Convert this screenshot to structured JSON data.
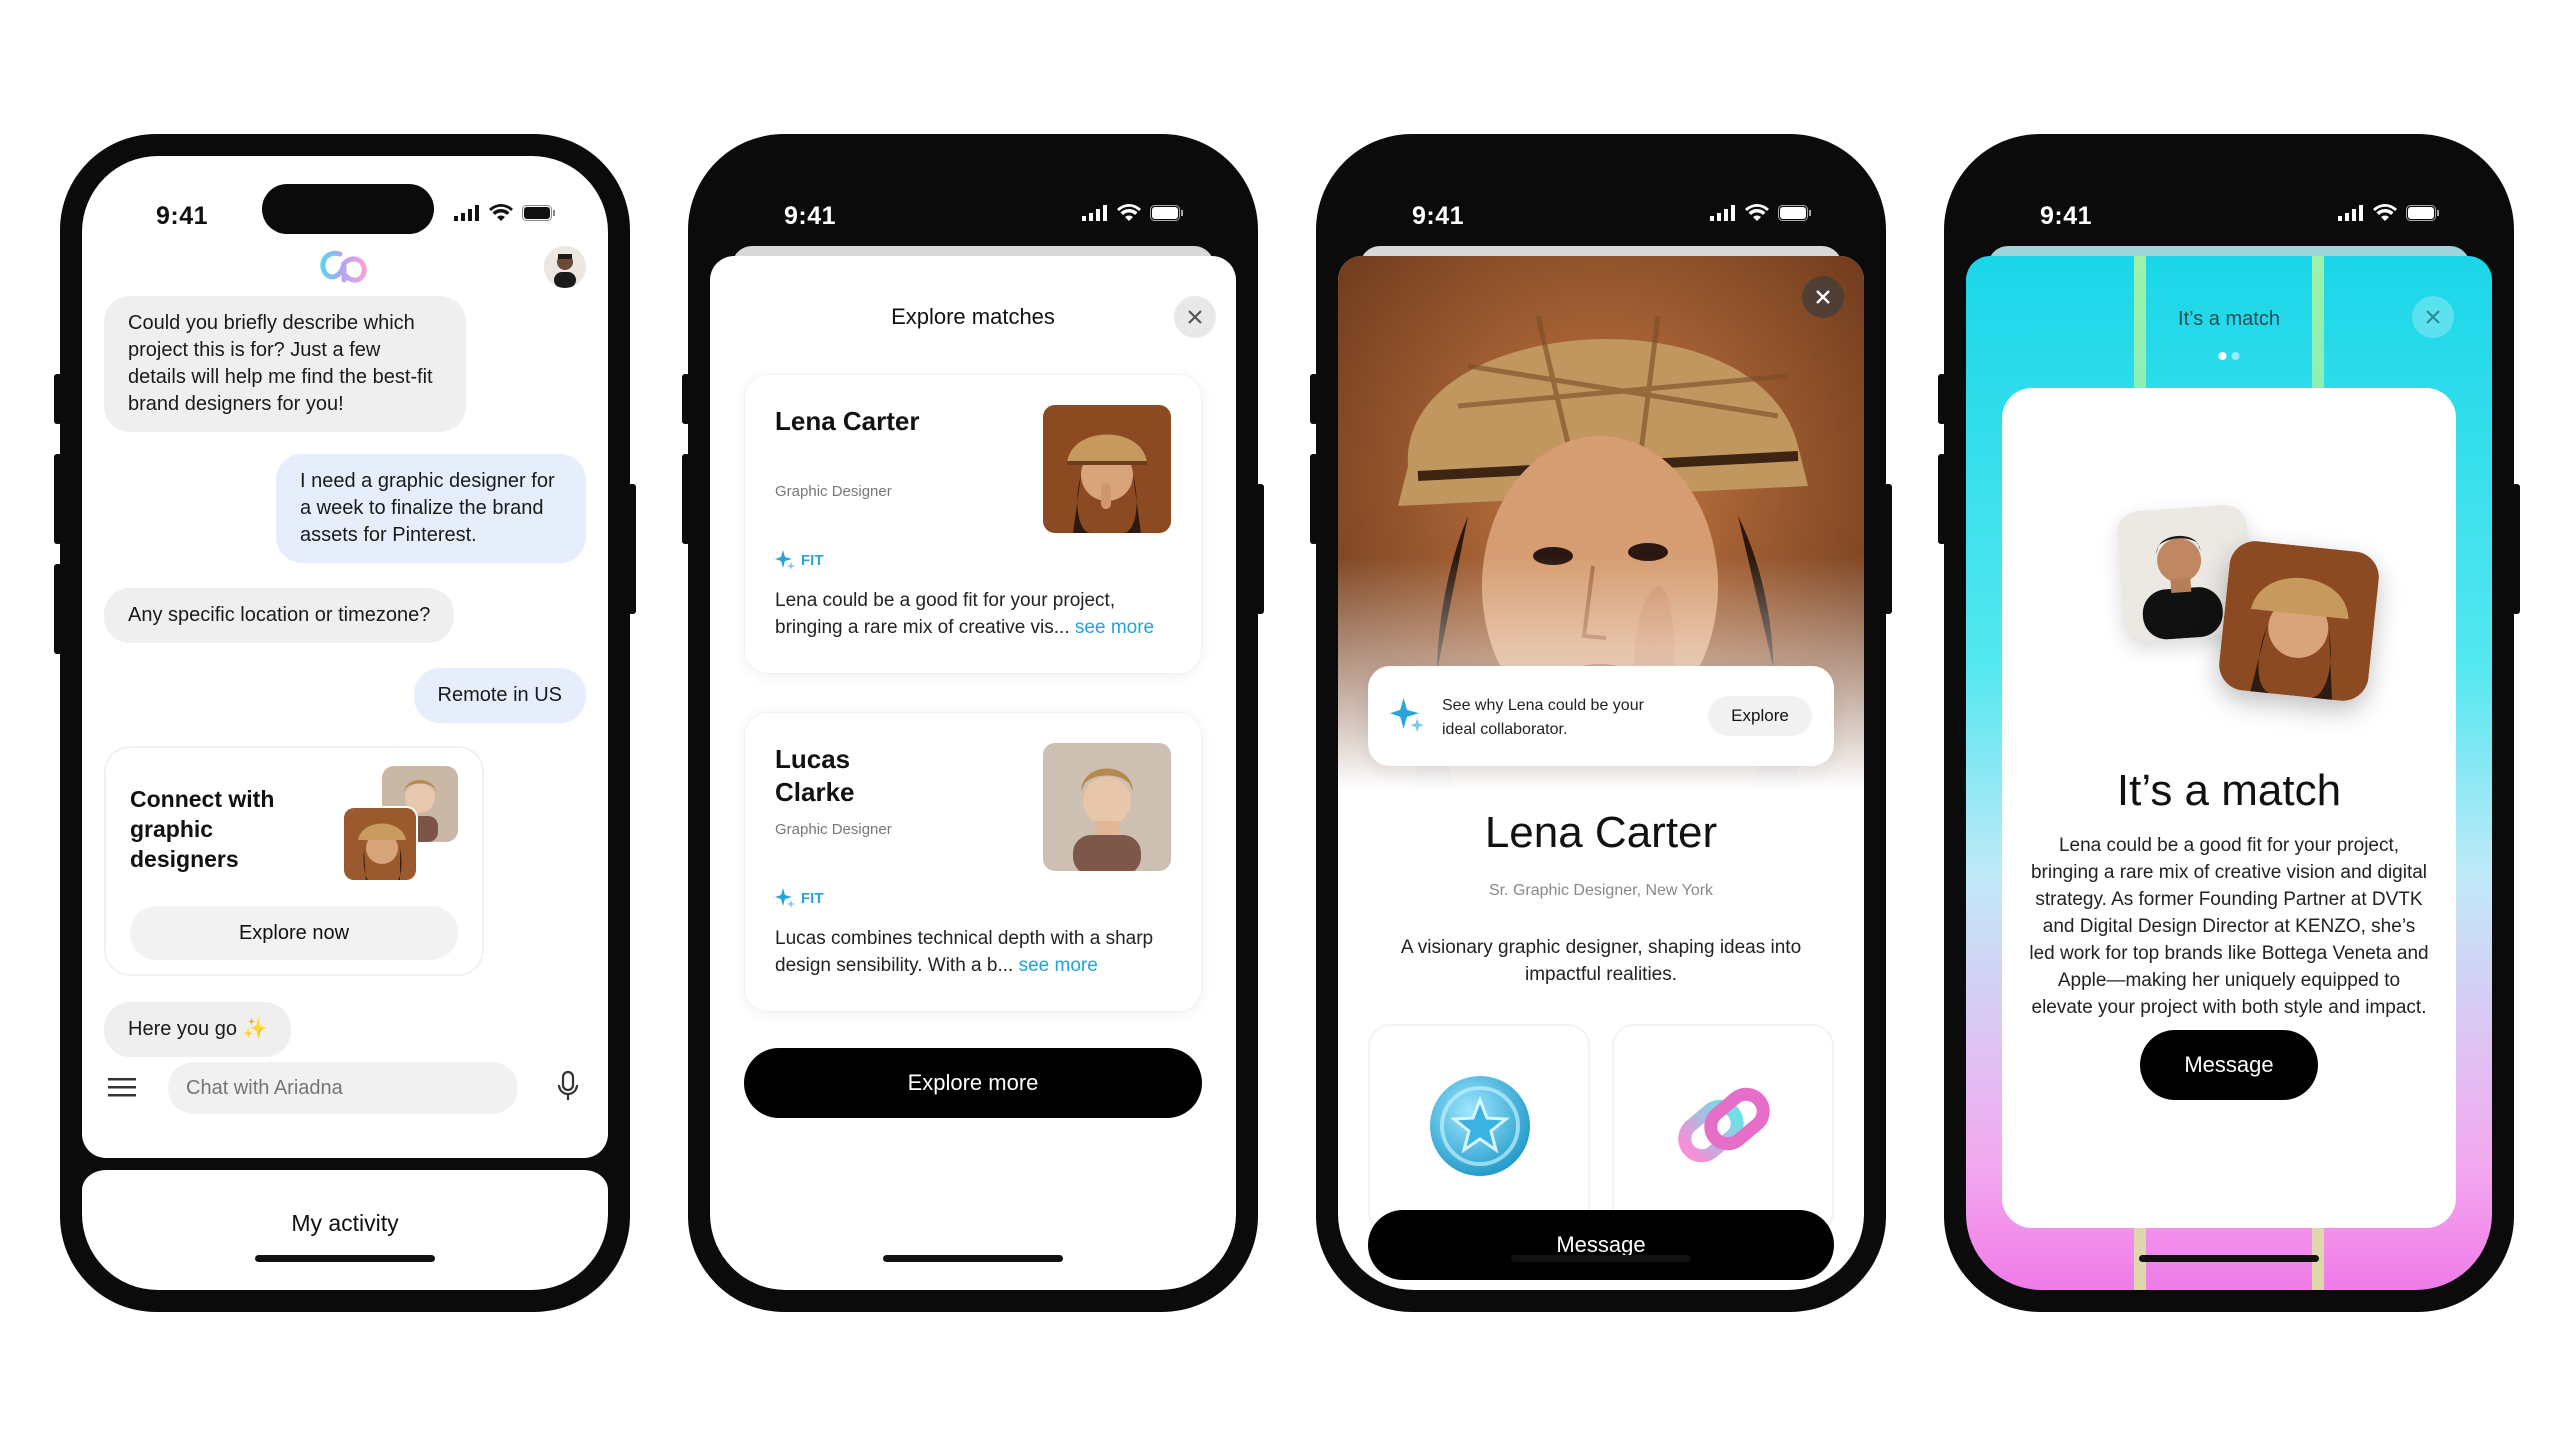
{
  "status_bar": {
    "time": "9:41"
  },
  "screen1": {
    "messages": [
      {
        "from": "ai",
        "text": "Could you briefly describe which project this is for? Just a few details will help me find the best-fit brand designers for you!"
      },
      {
        "from": "user",
        "text": "I need a graphic designer for a week to finalize the brand assets for Pinterest."
      },
      {
        "from": "ai",
        "text": "Any specific location or timezone?"
      },
      {
        "from": "user",
        "text": "Remote in US"
      }
    ],
    "connect_card": {
      "title": "Connect with graphic designers",
      "button": "Explore now"
    },
    "closing_message": "Here you go",
    "closing_emoji": "✨",
    "input_placeholder": "Chat with Ariadna",
    "bottom_tab": "My activity"
  },
  "screen2": {
    "title": "Explore matches",
    "matches": [
      {
        "name": "Lena Carter",
        "role": "Graphic Designer",
        "fit_label": "FIT",
        "desc": "Lena could be a good fit for your project, bringing a rare mix of creative vis...",
        "more": "see more"
      },
      {
        "name": "Lucas Clarke",
        "role": "Graphic Designer",
        "fit_label": "FIT",
        "desc": "Lucas combines technical depth with a sharp design sensibility. With a b...",
        "more": "see more"
      }
    ],
    "explore_more": "Explore more"
  },
  "screen3": {
    "why_text": "See why Lena could be your ideal collaborator.",
    "why_button": "Explore",
    "name": "Lena Carter",
    "role": "Sr. Graphic Designer, New York",
    "bio": "A visionary graphic designer, shaping ideas into impactful realities.",
    "message_button": "Message"
  },
  "screen4": {
    "label": "It’s a match",
    "title": "It’s a match",
    "desc": "Lena could be a good fit for your project, bringing a rare mix of creative vision and digital strategy. As former Founding Partner at DVTK and Digital Design Director at KENZO, she’s led work for top brands like Bottega Veneta and Apple—making her uniquely equipped to elevate your project with both style and impact.",
    "message_button": "Message"
  },
  "colors": {
    "accent_blue": "#21a2dc",
    "bubble_user": "#e6eefc",
    "bubble_ai": "#efefef",
    "match_cyan": "#1ad6e8",
    "match_pink": "#f07be8"
  }
}
